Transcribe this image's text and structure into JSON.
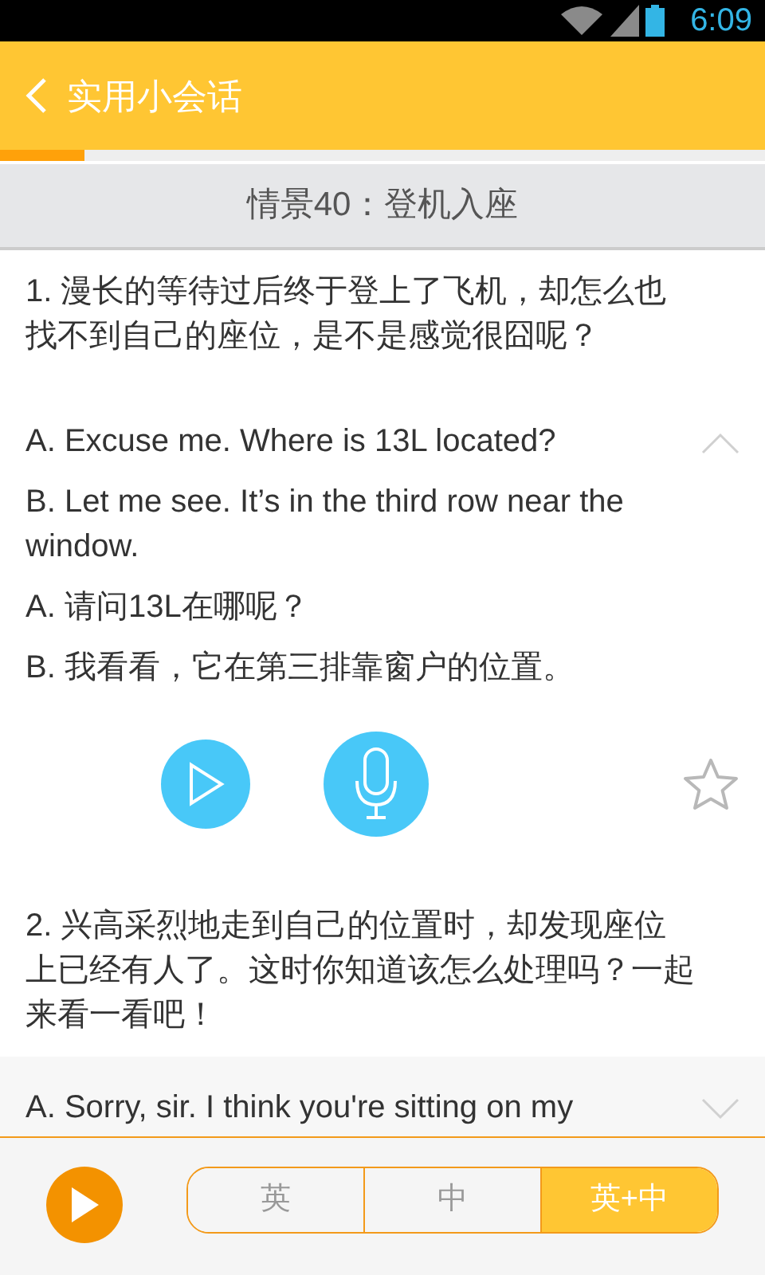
{
  "status_bar": {
    "time": "6:09"
  },
  "header": {
    "title": "实用小会话"
  },
  "progress": {
    "level": 0.11
  },
  "scene_title": "情景40：登机入座",
  "items": [
    {
      "question": "1. 漫长的等待过后终于登上了飞机，却怎么也找不到自己的座位，是不是感觉很囧呢？",
      "expanded": true,
      "starred": false,
      "lines": [
        "A. Excuse me. Where is 13L located?",
        "B. Let me see. It’s in the third row near the window.",
        "A. 请问13L在哪呢？",
        "B. 我看看，它在第三排靠窗户的位置。"
      ]
    },
    {
      "question": "2. 兴高采烈地走到自己的位置时，却发现座位上已经有人了。这时你知道该怎么处理吗？一起来看一看吧！",
      "expanded": false,
      "lines": [
        "A. Sorry, sir. I think you're sitting on my"
      ]
    }
  ],
  "modes": [
    {
      "label": "英",
      "selected": false
    },
    {
      "label": "中",
      "selected": false
    },
    {
      "label": "英+中",
      "selected": true
    }
  ]
}
